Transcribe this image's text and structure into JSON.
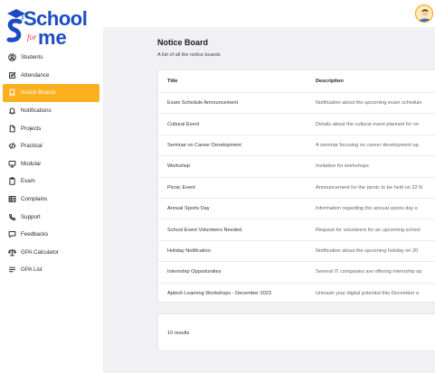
{
  "brand": {
    "top": "School",
    "for": "for",
    "me": "me"
  },
  "nav": [
    {
      "label": "Students",
      "icon": "user-circle-icon"
    },
    {
      "label": "Attendance",
      "icon": "pencil-square-icon"
    },
    {
      "label": "Notice Boards",
      "icon": "bookmark-icon",
      "active": true
    },
    {
      "label": "Notifications",
      "icon": "bell-icon"
    },
    {
      "label": "Projects",
      "icon": "file-icon"
    },
    {
      "label": "Practical",
      "icon": "code-icon"
    },
    {
      "label": "Modular",
      "icon": "monitor-icon"
    },
    {
      "label": "Exam",
      "icon": "clipboard-icon"
    },
    {
      "label": "Complains",
      "icon": "table-icon"
    },
    {
      "label": "Support",
      "icon": "phone-icon"
    },
    {
      "label": "Feedbacks",
      "icon": "chat-icon"
    },
    {
      "label": "GPA Calculator",
      "icon": "scale-icon"
    },
    {
      "label": "GPA List",
      "icon": "list-icon"
    }
  ],
  "page": {
    "title": "Notice Board",
    "subtitle": "A list of all the notice boards"
  },
  "table": {
    "headers": {
      "title": "Title",
      "description": "Description"
    },
    "rows": [
      {
        "title": "Exam Schedule Announcement",
        "description": "Notification about the upcoming exam schedule"
      },
      {
        "title": "Cultural Event",
        "description": "Details about the cultural event planned for ne"
      },
      {
        "title": "Seminar on Career Development",
        "description": "A seminar focusing on career development ap"
      },
      {
        "title": "Workshop",
        "description": "Invitation for workshops"
      },
      {
        "title": "Picnic Event",
        "description": "Announcement for the picnic to be held on 22 N"
      },
      {
        "title": "Annual Sports Day",
        "description": "Information regarding the annual sports day e"
      },
      {
        "title": "School Event Volunteers Needed",
        "description": "Request for volunteers for an upcoming school"
      },
      {
        "title": "Holiday Notification",
        "description": "Notification about the upcoming holiday on 20"
      },
      {
        "title": "Internship Opportunities",
        "description": "Several IT companies are offering internship op"
      },
      {
        "title": "Aptech Learning Workshops - December 2023",
        "description": "Unleash your digital potential this December a"
      }
    ]
  },
  "footer": {
    "results": "10 results"
  },
  "colors": {
    "accent": "#fbb01e",
    "brand_blue": "#1b4cc2",
    "brand_red": "#e0312f"
  }
}
